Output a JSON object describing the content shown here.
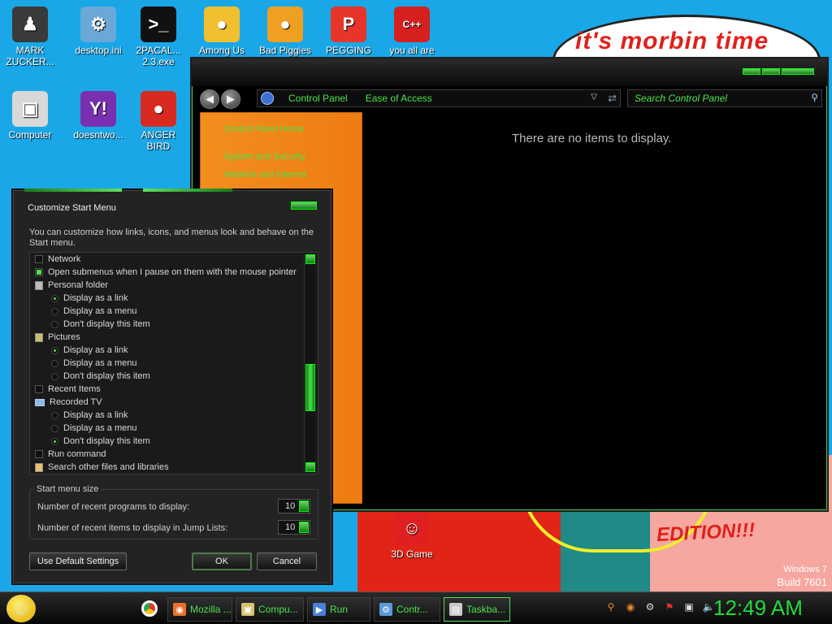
{
  "wallpaper": {
    "bubble_text": "it's morbin time",
    "edition_text": "EDITION!!!",
    "windows_version": "Windows 7",
    "build": "Build 7601"
  },
  "desktop_icons": [
    {
      "label": "MARK\nZUCKER...",
      "icon": "person-icon",
      "color": "#3a3a3a"
    },
    {
      "label": "desktop.ini",
      "icon": "settings-file-icon",
      "color": "#6aa8d8"
    },
    {
      "label": "2PACAL...\n2.3.exe",
      "icon": "console-icon",
      "color": "#111111"
    },
    {
      "label": "Among Us",
      "icon": "among-us-icon",
      "color": "#f0c030"
    },
    {
      "label": "Bad Piggies",
      "icon": "pig-icon",
      "color": "#f0a020"
    },
    {
      "label": "PEGGING",
      "icon": "p-logo-icon",
      "color": "#e8352a"
    },
    {
      "label": "you all are",
      "icon": "devcpp-icon",
      "color": "#d62020"
    },
    {
      "label": "Computer",
      "icon": "computer-icon",
      "color": "#d8d8d8"
    },
    {
      "label": "doesntwo...",
      "icon": "yahoo-icon",
      "color": "#7a2fb0"
    },
    {
      "label": "ANGER\nBIRD",
      "icon": "angry-bird-icon",
      "color": "#d82a20"
    },
    {
      "label": "3D Game",
      "icon": "game-icon",
      "color": "#e02020"
    }
  ],
  "control_panel": {
    "breadcrumbs": [
      "Control Panel",
      "Ease of Access"
    ],
    "search_placeholder": "Search Control Panel",
    "side_links": [
      "Control Panel Home",
      "System and Security",
      "Network and Internet"
    ],
    "empty_message": "There are no items to display."
  },
  "dialog": {
    "title": "Customize Start Menu",
    "description": "You can customize how links, icons, and menus look and behave on the Start menu.",
    "options": [
      {
        "kind": "check",
        "label": "Network",
        "checked": false
      },
      {
        "kind": "check",
        "label": "Open submenus when I pause on them with the mouse pointer",
        "checked": true
      },
      {
        "kind": "folder",
        "label": "Personal folder"
      },
      {
        "kind": "radio",
        "label": "Display as a link",
        "checked": true
      },
      {
        "kind": "radio",
        "label": "Display as a menu",
        "checked": false
      },
      {
        "kind": "radio",
        "label": "Don't display this item",
        "checked": false
      },
      {
        "kind": "folder",
        "label": "Pictures"
      },
      {
        "kind": "radio",
        "label": "Display as a link",
        "checked": true
      },
      {
        "kind": "radio",
        "label": "Display as a menu",
        "checked": false
      },
      {
        "kind": "radio",
        "label": "Don't display this item",
        "checked": false
      },
      {
        "kind": "check",
        "label": "Recent Items",
        "checked": false
      },
      {
        "kind": "folder",
        "label": "Recorded TV"
      },
      {
        "kind": "radio",
        "label": "Display as a link",
        "checked": false
      },
      {
        "kind": "radio",
        "label": "Display as a menu",
        "checked": false
      },
      {
        "kind": "radio",
        "label": "Don't display this item",
        "checked": true
      },
      {
        "kind": "check",
        "label": "Run command",
        "checked": false
      },
      {
        "kind": "folder",
        "label": "Search other files and libraries"
      }
    ],
    "start_menu_size_title": "Start menu size",
    "recent_programs_label": "Number of recent programs to display:",
    "recent_programs_value": "10",
    "jump_list_label": "Number of recent items to display in Jump Lists:",
    "jump_list_value": "10",
    "default_button": "Use Default Settings",
    "ok_button": "OK",
    "cancel_button": "Cancel"
  },
  "taskbar": {
    "items": [
      {
        "label": "Mozilla ...",
        "icon": "firefox-icon",
        "color": "#e8702a"
      },
      {
        "label": "Compu...",
        "icon": "computer-icon",
        "color": "#d8c070"
      },
      {
        "label": "Run",
        "icon": "run-icon",
        "color": "#4a80d8"
      },
      {
        "label": "Contr...",
        "icon": "control-panel-icon",
        "color": "#5a9ad8"
      },
      {
        "label": "Taskba...",
        "icon": "taskbar-props-icon",
        "color": "#c8c8c8"
      }
    ],
    "clock": "12:49 AM"
  }
}
